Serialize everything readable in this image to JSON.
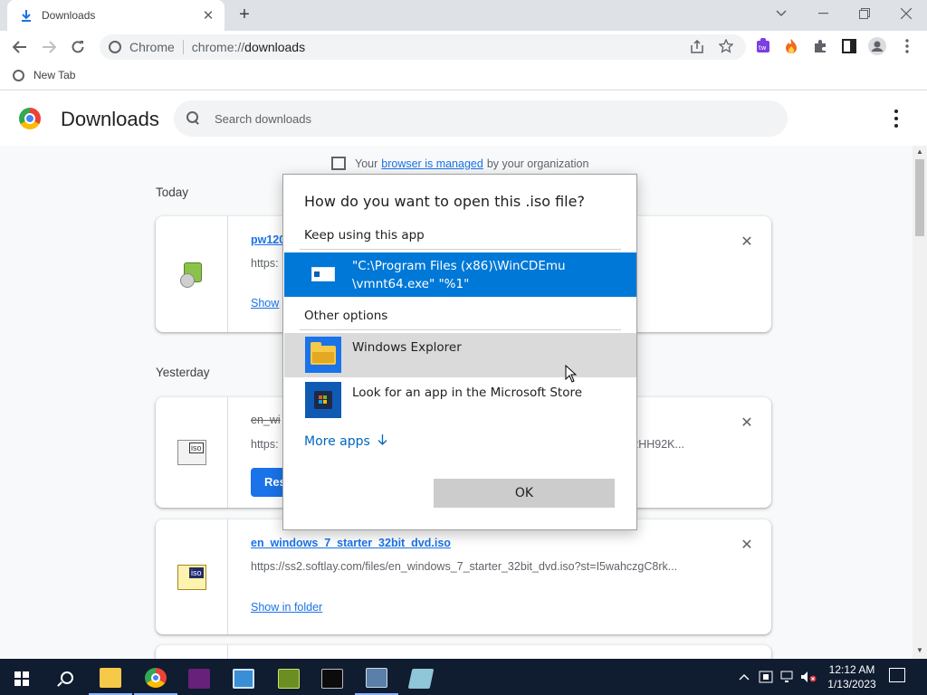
{
  "browser": {
    "tab": {
      "title": "Downloads",
      "icon": "download-icon"
    },
    "omnibox": {
      "site_label": "Chrome",
      "url_scheme": "chrome://",
      "url_path": "downloads"
    },
    "bookmarks": [
      {
        "label": "New Tab",
        "icon": "globe-icon"
      }
    ]
  },
  "page": {
    "title": "Downloads",
    "search_placeholder": "Search downloads",
    "managed": {
      "prefix": "Your",
      "link": "browser is managed",
      "suffix": "by your organization"
    },
    "sections": [
      {
        "label": "Today"
      },
      {
        "label": "Yesterday"
      }
    ],
    "items": [
      {
        "name": "pw120",
        "url": "https:",
        "action": "Show",
        "icon": "cd-package-icon"
      },
      {
        "name": "en_wi",
        "url_start": "https:",
        "url_end": "z2HH92K...",
        "action": "Res",
        "icon": "iso-file-icon",
        "struck": true
      },
      {
        "name": "en_windows_7_starter_32bit_dvd.iso",
        "url": "https://ss2.softlay.com/files/en_windows_7_starter_32bit_dvd.iso?st=I5wahczgC8rk...",
        "action": "Show in folder",
        "icon": "iso-file-icon"
      }
    ],
    "close_glyph": "✕"
  },
  "dialog": {
    "title": "How do you want to open this .iso file?",
    "keep_label": "Keep using this app",
    "current_app": {
      "line1": "\"C:\\Program Files (x86)\\WinCDEmu",
      "line2": "\\vmnt64.exe\" \"%1\""
    },
    "other_label": "Other options",
    "options": [
      {
        "label": "Windows Explorer",
        "icon": "file-explorer-icon"
      },
      {
        "label": "Look for an app in the Microsoft Store",
        "icon": "microsoft-store-icon"
      }
    ],
    "more_apps": "More apps",
    "ok": "OK"
  },
  "taskbar": {
    "time": "12:12 AM",
    "date": "1/13/2023",
    "apps": [
      "file-explorer",
      "chrome",
      "visual-studio",
      "remote-desktop",
      "keepass",
      "command-prompt",
      "package-installer",
      "notepad"
    ]
  },
  "colors": {
    "accent": "#1a73e8",
    "selection": "#0078d7",
    "taskbar": "#101c30"
  }
}
